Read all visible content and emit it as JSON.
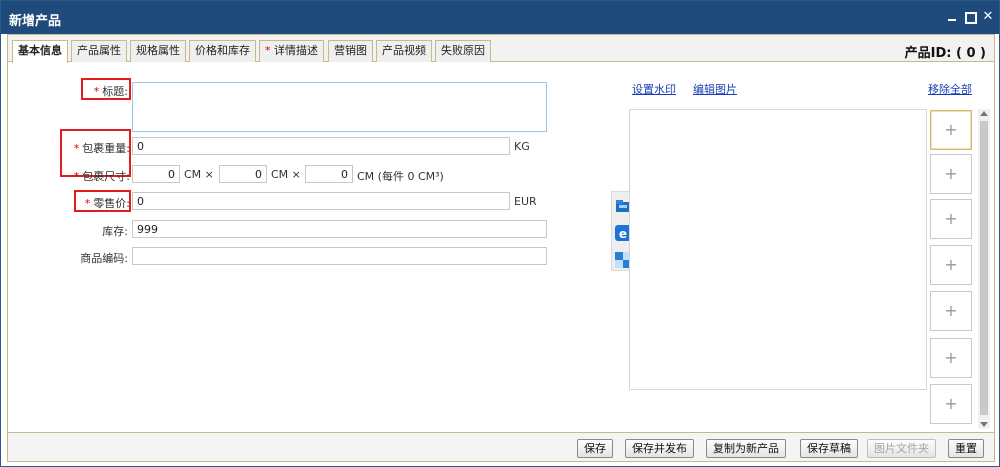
{
  "window": {
    "title": "新增产品"
  },
  "tabs": [
    {
      "label": "基本信息",
      "required": false,
      "active": true
    },
    {
      "label": "产品属性",
      "required": false,
      "active": false
    },
    {
      "label": "规格属性",
      "required": false,
      "active": false
    },
    {
      "label": "价格和库存",
      "required": false,
      "active": false
    },
    {
      "label": "详情描述",
      "required": true,
      "active": false
    },
    {
      "label": "营销图",
      "required": false,
      "active": false
    },
    {
      "label": "产品视频",
      "required": false,
      "active": false
    },
    {
      "label": "失败原因",
      "required": false,
      "active": false
    }
  ],
  "product_id": "产品ID: ( 0 )",
  "required_mark": "*",
  "form": {
    "title": {
      "label": "标题:",
      "value": ""
    },
    "weight": {
      "label": "包裹重量:",
      "value": "0",
      "unit": "KG"
    },
    "size": {
      "label": "包裹尺寸:",
      "length": "0",
      "width": "0",
      "height": "0",
      "unit1": "CM ×",
      "unit2": "CM ×",
      "unit3": "CM (每件  0 CM³)"
    },
    "price": {
      "label": "零售价:",
      "value": "0",
      "unit": "EUR"
    },
    "stock": {
      "label": "库存:",
      "value": "999"
    },
    "sku": {
      "label": "商品编码:",
      "value": ""
    }
  },
  "images": {
    "watermark_link": "设置水印",
    "edit_link": "编辑图片",
    "remove_all_link": "移除全部",
    "add_symbol": "+"
  },
  "footer": {
    "save": "保存",
    "save_publish": "保存并发布",
    "copy_new": "复制为新产品",
    "save_draft": "保存草稿",
    "image_folder": "图片文件夹",
    "reset": "重置"
  },
  "colors": {
    "titlebar": "#1e4a7c",
    "required": "#dd0000",
    "highlight_box": "#e31d1d",
    "link": "#1a3db5"
  }
}
